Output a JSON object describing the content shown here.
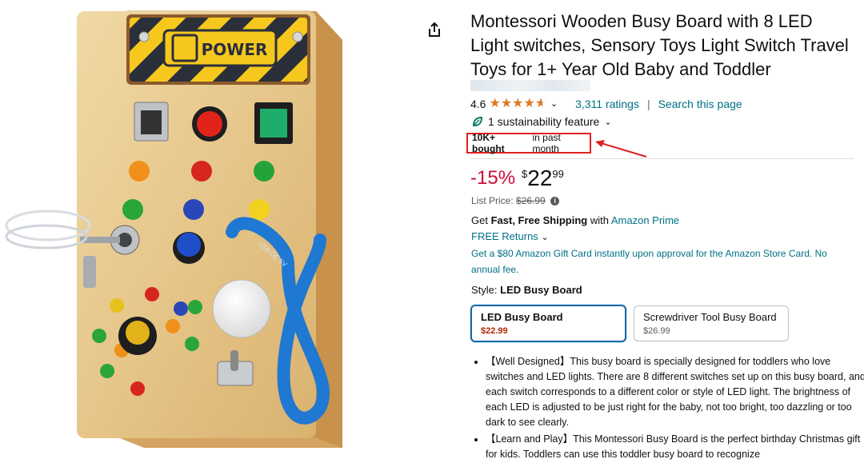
{
  "product": {
    "title": "Montessori Wooden Busy Board with 8 LED Light switches, Sensory Toys Light Switch Travel Toys for 1+ Year Old Baby and Toddler",
    "image_logo_text": "POWER",
    "image_cable_text": "USB DC 5V"
  },
  "rating": {
    "value": "4.6",
    "count_text": "3,311 ratings",
    "search_link": "Search this page",
    "separator": "|"
  },
  "sustainability": {
    "text": "1 sustainability feature"
  },
  "bought": {
    "bold": "10K+ bought",
    "rest": "in past month"
  },
  "price": {
    "discount": "-15%",
    "currency": "$",
    "whole": "22",
    "fraction": "99",
    "list_label": "List Price:",
    "list_value": "$26.99"
  },
  "shipping": {
    "prefix": "Get",
    "bold": "Fast, Free Shipping",
    "with": "with",
    "link": "Amazon Prime"
  },
  "returns": {
    "text": "FREE Returns"
  },
  "giftcard": {
    "text": "Get a $80 Amazon Gift Card instantly upon approval for the Amazon Store Card. No annual fee."
  },
  "style": {
    "label": "Style:",
    "selected": "LED Busy Board",
    "options": [
      {
        "name": "LED Busy Board",
        "price": "$22.99"
      },
      {
        "name": "Screwdriver Tool Busy Board",
        "price": "$26.99"
      }
    ]
  },
  "bullets": [
    "【Well Designed】This busy board is specially designed for toddlers who love switches and LED lights. There are 8 different switches set up on this busy board, and each switch corresponds to a different color or style of LED light. The brightness of each LED is adjusted to be just right for the baby, not too bright, too dazzling or too dark to see clearly.",
    "【Learn and Play】This Montessori Busy Board is the perfect birthday Christmas gift for kids. Toddlers can use this toddler busy board to recognize"
  ],
  "colors": {
    "link": "#007185",
    "discount": "#cc0c39",
    "star": "#de7921",
    "highlight_box": "#e02020",
    "selected_border": "#2162a1"
  }
}
